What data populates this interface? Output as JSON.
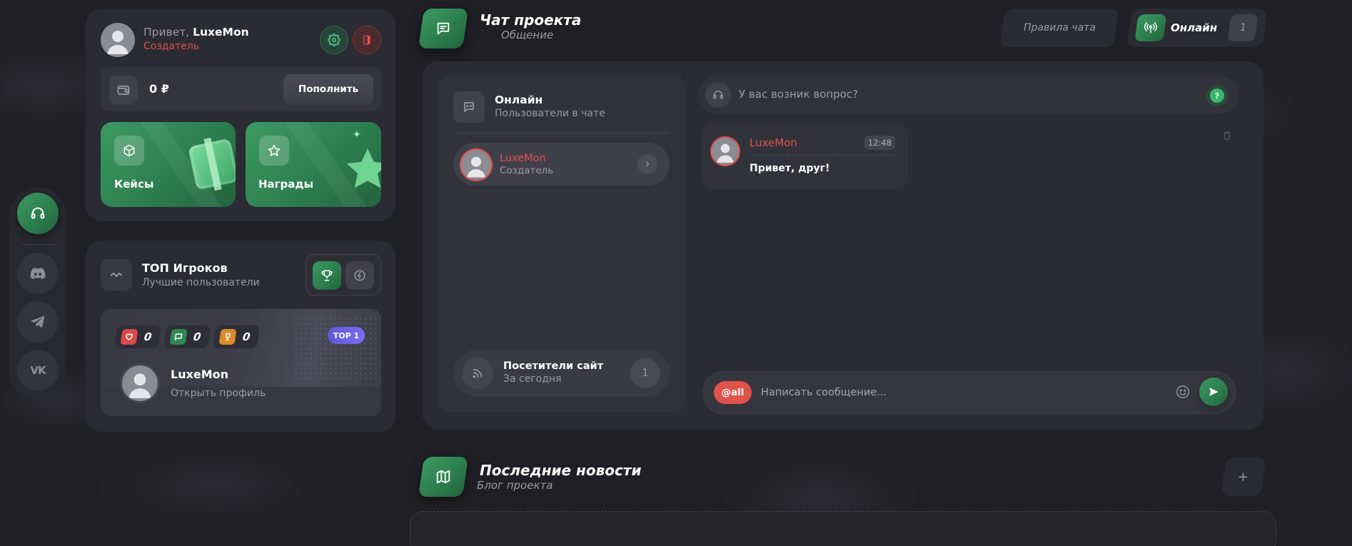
{
  "sidebar_icons": [
    {
      "name": "support-icon"
    },
    {
      "name": "discord-icon"
    },
    {
      "name": "telegram-icon"
    },
    {
      "name": "vk-icon"
    }
  ],
  "profile": {
    "greeting": "Привет,",
    "username": "LuxeMon",
    "role": "Создатель",
    "balance": "0 ₽",
    "topup_label": "Пополнить"
  },
  "promo": {
    "cases_label": "Кейсы",
    "rewards_label": "Награды"
  },
  "top_players": {
    "title": "ТОП Игроков",
    "subtitle": "Лучшие пользователи",
    "badge": "TOP 1",
    "likes": "0",
    "messages": "0",
    "trophies": "0",
    "username": "LuxeMon",
    "profile_link": "Открыть профиль"
  },
  "chat": {
    "title": "Чат проекта",
    "subtitle": "Общение",
    "rules_label": "Правила чата",
    "online_label": "Онлайн",
    "online_count": "1",
    "online_panel_title": "Онлайн",
    "online_panel_subtitle": "Пользователи в чате",
    "user_name": "LuxeMon",
    "user_role": "Создатель",
    "visitors_title": "Посетители сайт",
    "visitors_subtitle": "За сегодня",
    "visitors_count": "1",
    "question_text": "У вас возник вопрос?",
    "question_badge": "?",
    "message_author": "LuxeMon",
    "message_time": "12:48",
    "message_text": "Привет, друг!",
    "mention_label": "@all",
    "input_placeholder": "Написать сообщение..."
  },
  "news": {
    "title": "Последние новости",
    "subtitle": "Блог проекта",
    "add_label": "+"
  },
  "colors": {
    "accent_green": "#2f8a55",
    "accent_red": "#e0534a",
    "badge_purple": "#6c5ce7"
  }
}
